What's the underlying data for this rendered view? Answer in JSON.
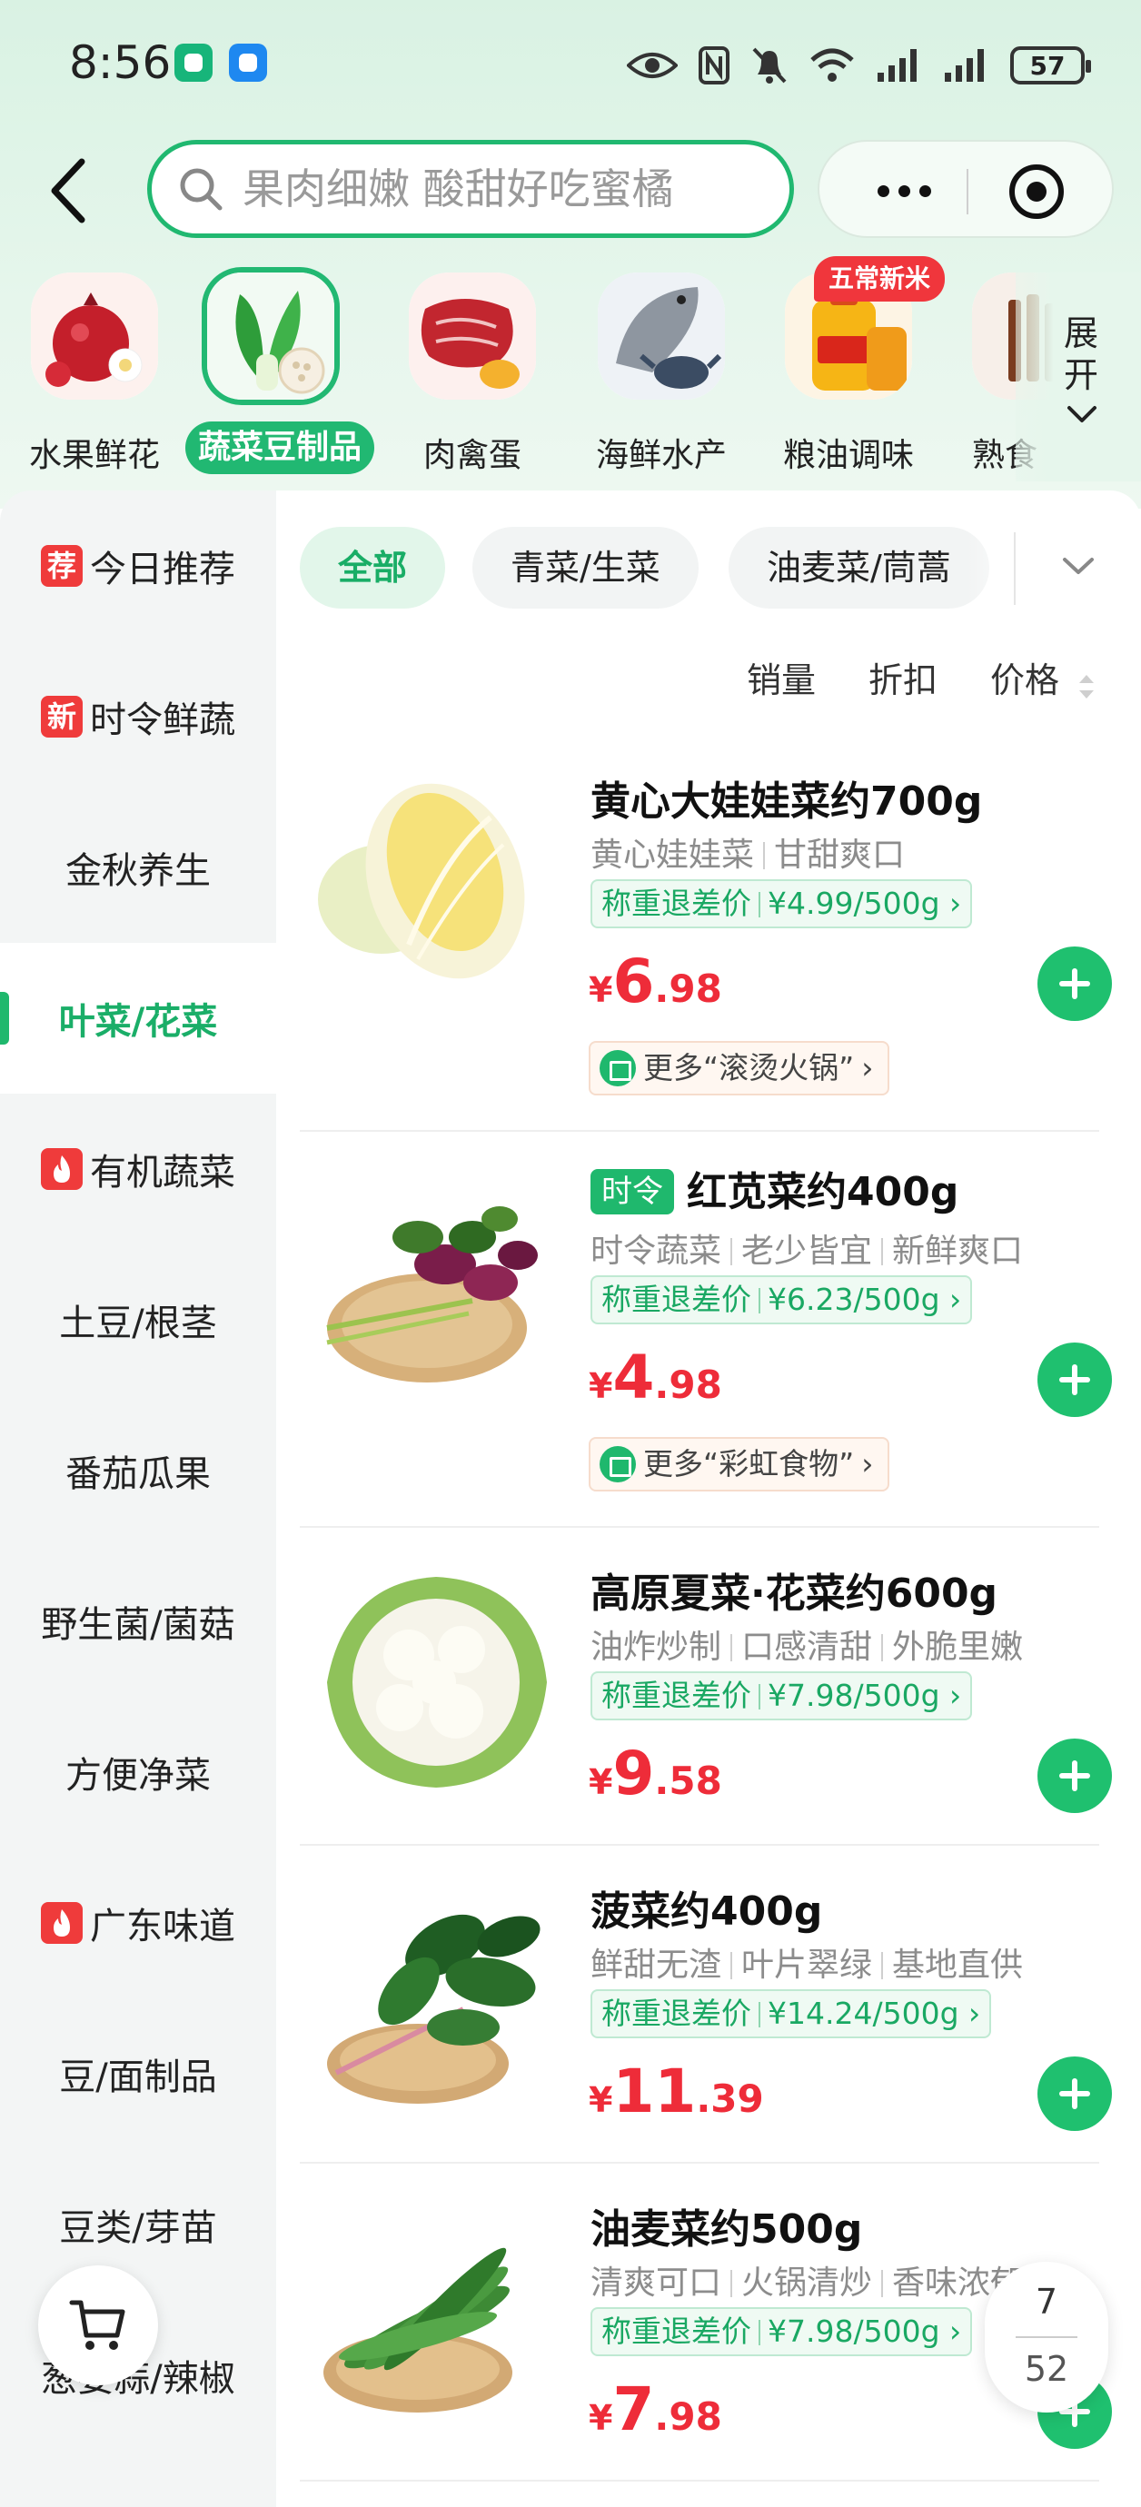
{
  "status_bar": {
    "time": "8:56",
    "battery": "57"
  },
  "search": {
    "placeholder": "果肉细嫩 酸甜好吃蜜橘"
  },
  "categories": [
    {
      "label": "水果鲜花"
    },
    {
      "label": "蔬菜豆制品"
    },
    {
      "label": "肉禽蛋"
    },
    {
      "label": "海鲜水产"
    },
    {
      "label": "粮油调味",
      "badge": "五常新米"
    },
    {
      "label": "熟食"
    }
  ],
  "expand_label": "展开",
  "sidebar": {
    "items": [
      {
        "label": "今日推荐",
        "tag": "荐"
      },
      {
        "label": "时令鲜蔬",
        "tag": "新"
      },
      {
        "label": "金秋养生"
      },
      {
        "label": "叶菜/花菜",
        "active": true
      },
      {
        "label": "有机蔬菜",
        "tag": "fire"
      },
      {
        "label": "土豆/根茎"
      },
      {
        "label": "番茄瓜果"
      },
      {
        "label": "野生菌/菌菇"
      },
      {
        "label": "方便净菜"
      },
      {
        "label": "广东味道",
        "tag": "fire"
      },
      {
        "label": "豆/面制品"
      },
      {
        "label": "豆类/芽苗"
      },
      {
        "label": "葱姜蒜/辣椒"
      }
    ]
  },
  "subtabs": [
    "全部",
    "青菜/生菜",
    "油麦菜/茼蒿"
  ],
  "sort": {
    "sales": "销量",
    "discount": "折扣",
    "price": "价格"
  },
  "products": [
    {
      "name": "黄心大娃娃菜约700g",
      "desc": [
        "黄心娃娃菜",
        "甘甜爽口"
      ],
      "unit_label": "称重退差价",
      "unit_price": "¥4.99/500g",
      "price_yen": "¥",
      "price_int": "6",
      "price_dec": ".98",
      "more": "更多“滚烫火锅”"
    },
    {
      "tag": "时令",
      "name": "红苋菜约400g",
      "desc": [
        "时令蔬菜",
        "老少皆宜",
        "新鲜爽口"
      ],
      "unit_label": "称重退差价",
      "unit_price": "¥6.23/500g",
      "price_yen": "¥",
      "price_int": "4",
      "price_dec": ".98",
      "more": "更多“彩虹食物”"
    },
    {
      "name": "高原夏菜·花菜约600g",
      "desc": [
        "油炸炒制",
        "口感清甜",
        "外脆里嫩"
      ],
      "unit_label": "称重退差价",
      "unit_price": "¥7.98/500g",
      "price_yen": "¥",
      "price_int": "9",
      "price_dec": ".58"
    },
    {
      "name": "菠菜约400g",
      "desc": [
        "鲜甜无渣",
        "叶片翠绿",
        "基地直供"
      ],
      "unit_label": "称重退差价",
      "unit_price": "¥14.24/500g",
      "price_yen": "¥",
      "price_int": "11",
      "price_dec": ".39"
    },
    {
      "name": "油麦菜约500g",
      "desc": [
        "清爽可口",
        "火锅清炒",
        "香味浓郁"
      ],
      "unit_label": "称重退差价",
      "unit_price": "¥7.98/500g",
      "price_yen": "¥",
      "price_int": "7",
      "price_dec": ".98"
    }
  ],
  "pager": {
    "current": "7",
    "total": "52"
  },
  "colors": {
    "accent": "#1fb86d",
    "price": "#ee2c39",
    "badge": "#f0363c"
  }
}
